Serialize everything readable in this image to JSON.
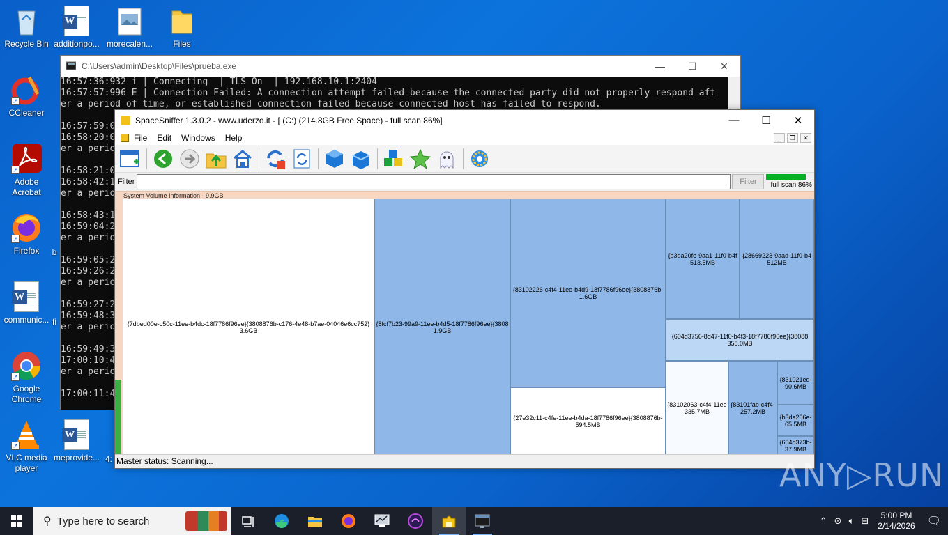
{
  "desktop": {
    "icons": [
      {
        "label": "Recycle Bin",
        "icon": "recycle-bin-icon"
      },
      {
        "label": "additionpo...",
        "icon": "word-doc-icon"
      },
      {
        "label": "morecalen...",
        "icon": "image-file-icon"
      },
      {
        "label": "Files",
        "icon": "folder-icon"
      },
      {
        "label": "CCleaner",
        "icon": "ccleaner-icon"
      },
      {
        "label": "Adobe Acrobat",
        "icon": "acrobat-icon"
      },
      {
        "label": "Firefox",
        "icon": "firefox-icon"
      },
      {
        "label": "communic...",
        "icon": "word-doc-icon"
      },
      {
        "label": "Google Chrome",
        "icon": "chrome-icon"
      },
      {
        "label": "VLC media player",
        "icon": "vlc-icon"
      },
      {
        "label": "meprovide...",
        "icon": "word-doc-icon"
      }
    ],
    "partial_labels": {
      "b": "b",
      "fi": "fi",
      "four": "4:"
    }
  },
  "console": {
    "title": "C:\\Users\\admin\\Desktop\\Files\\prueba.exe",
    "lines": "16:57:36:932 i | Connecting  | TLS On  | 192.168.10.1:2404\n16:57:57:996 E | Connection Failed: A connection attempt failed because the connected party did not properly respond aft\ner a period of time, or established connection failed because connected host has failed to respond.\n\n16:57:59:0\n16:58:20:0\ner a perio\n\n16:58:21:0\n16:58:42:1\ner a perio\n\n16:58:43:1\n16:59:04:2\ner a perio\n\n16:59:05:2\n16:59:26:2\ner a perio\n\n16:59:27:2\n16:59:48:3\ner a perio\n\n16:59:49:3\n17:00:10:4\ner a perio\n\n17:00:11:4"
  },
  "spacesniffer": {
    "title": "SpaceSniffer 1.3.0.2 - www.uderzo.it - [ (C:) (214.8GB Free Space) - full scan 86%]",
    "menu": [
      "File",
      "Edit",
      "Windows",
      "Help"
    ],
    "filter_label": "Filter",
    "filter_value": "",
    "filter_button": "Filter",
    "scan_status": "full scan 86%",
    "scan_progress": 0.86,
    "root_label": "System Volume Information - 9.9GB",
    "tiles": [
      {
        "name": "{7dbed00e-c50c-11ee-b4dc-18f7786f96ee}{3808876b-c176-4e48-b7ae-04046e6cc752}",
        "size": "3.6GB"
      },
      {
        "name": "{8fcf7b23-99a9-11ee-b4d5-18f7786f96ee}{3808",
        "size": "1.9GB"
      },
      {
        "name": "{83102226-c4f4-11ee-b4d9-18f7786f96ee}{3808876b-",
        "size": "1.6GB"
      },
      {
        "name": "{27e32c11-c4fe-11ee-b4da-18f7786f96ee}{3808876b-",
        "size": "594.5MB"
      },
      {
        "name": "{b3da20fe-9aa1-11f0-b4f",
        "size": "513.5MB"
      },
      {
        "name": "{28669223-9aad-11f0-b4",
        "size": "512MB"
      },
      {
        "name": "{604d3756-8d47-11f0-b4f3-18f7786f96ee}{38088",
        "size": "358.0MB"
      },
      {
        "name": "{83102063-c4f4-11ee",
        "size": "335.7MB"
      },
      {
        "name": "{83101fab-c4f4-",
        "size": "257.2MB"
      },
      {
        "name": "{831021ed-",
        "size": "90.6MB"
      },
      {
        "name": "{b3da206e-",
        "size": "65.5MB"
      },
      {
        "name": "{604d373b-",
        "size": "37.9MB"
      }
    ],
    "status": "Master status: Scanning..."
  },
  "taskbar": {
    "search_placeholder": "Type here to search",
    "time": "5:00 PM",
    "date": "2/14/2026"
  },
  "watermark": "ANY▷RUN"
}
